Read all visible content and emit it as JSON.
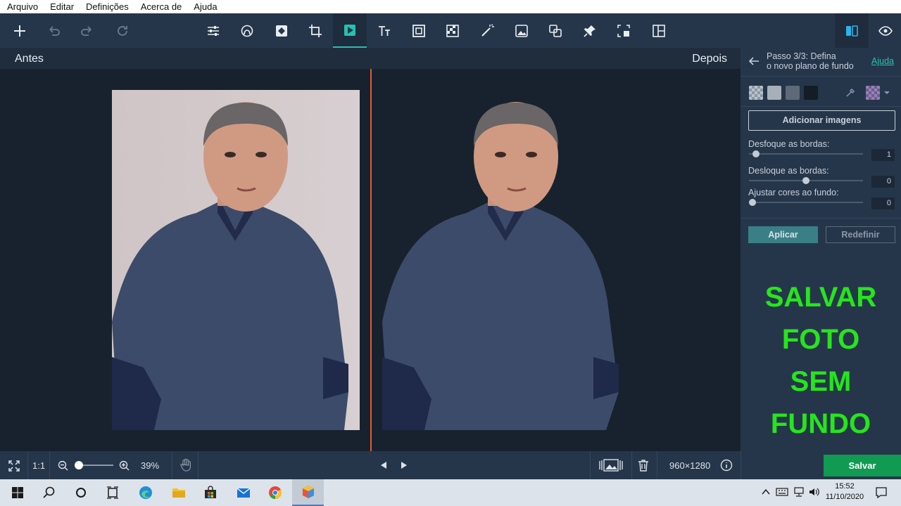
{
  "menu": {
    "items": [
      "Arquivo",
      "Editar",
      "Definições",
      "Acerca de",
      "Ajuda"
    ]
  },
  "labels": {
    "before": "Antes",
    "after": "Depois"
  },
  "panel": {
    "step_line1": "Passo 3/3: Defina",
    "step_line2": "o novo plano de fundo",
    "help": "Ajuda",
    "add_images": "Adicionar imagens",
    "blur_label": "Desfoque as bordas:",
    "blur_value": "1",
    "shift_label": "Desloque as bordas:",
    "shift_value": "0",
    "colors_label": "Ajustar cores ao fundo:",
    "colors_value": "0",
    "apply": "Aplicar",
    "reset": "Redefinir",
    "overlay_lines": [
      "SALVAR",
      "FOTO",
      "SEM",
      "FUNDO"
    ]
  },
  "bottom": {
    "actual_size": "1:1",
    "zoom": "39%",
    "dimensions": "960×1280",
    "save": "Salvar"
  },
  "taskbar": {
    "time": "15:52",
    "date": "11/10/2020"
  },
  "colors": {
    "accent": "#24c2b0",
    "divider": "#e05a3a",
    "save": "#119a52",
    "overlay": "#25e61c"
  }
}
